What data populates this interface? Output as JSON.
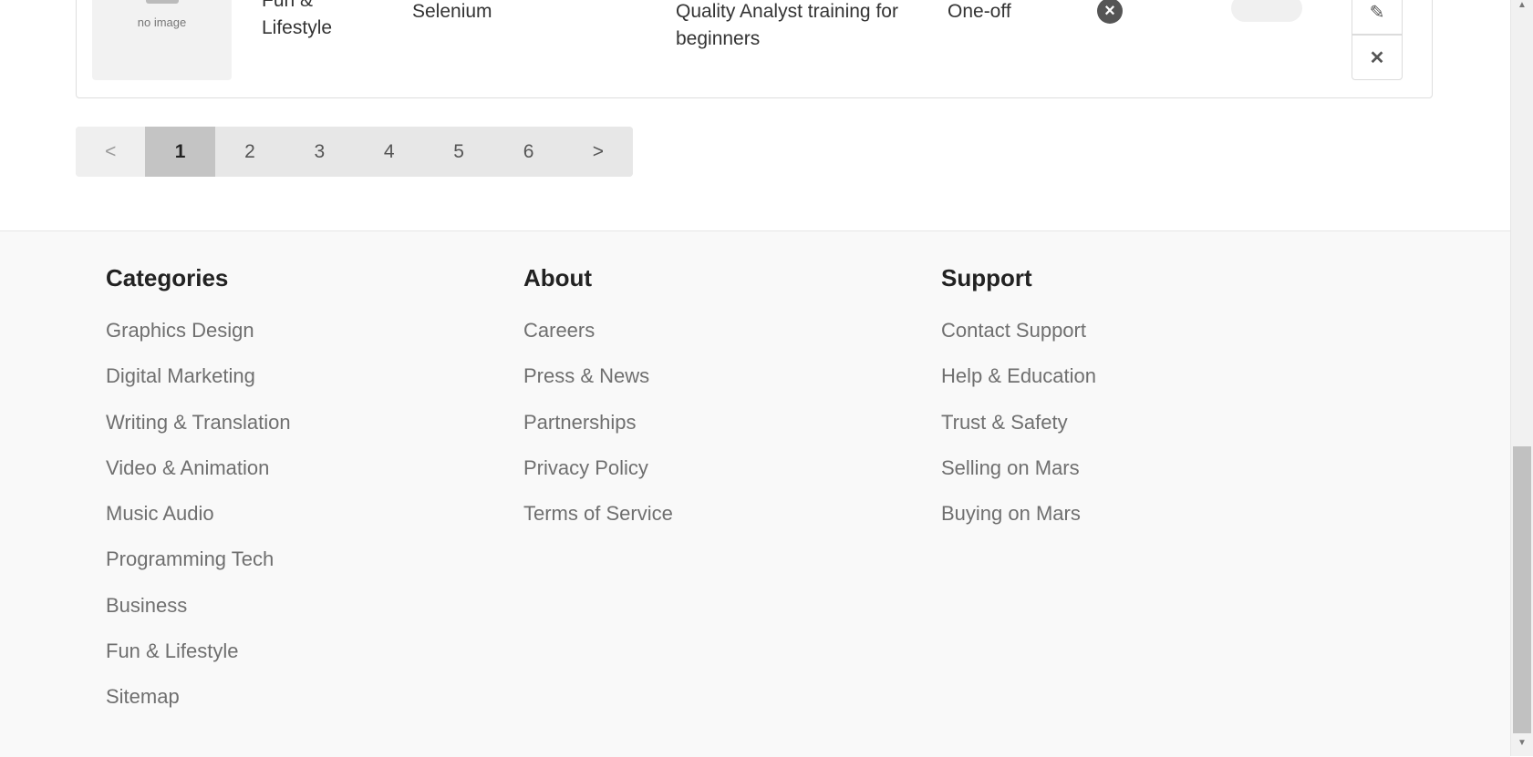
{
  "row": {
    "thumbnail_text": "no image",
    "category": "Fun & Lifestyle",
    "skill": "Selenium",
    "description": "Quality Analyst training for beginners",
    "type": "One-off",
    "status_icon": "close-circle-icon",
    "edit_icon": "pencil-icon",
    "delete_icon": "x-icon"
  },
  "pagination": {
    "prev": "<",
    "pages": [
      "1",
      "2",
      "3",
      "4",
      "5",
      "6"
    ],
    "active": "1",
    "next": ">"
  },
  "footer": {
    "categories": {
      "title": "Categories",
      "items": [
        "Graphics Design",
        "Digital Marketing",
        "Writing & Translation",
        "Video & Animation",
        "Music Audio",
        "Programming Tech",
        "Business",
        "Fun & Lifestyle",
        "Sitemap"
      ]
    },
    "about": {
      "title": "About",
      "items": [
        "Careers",
        "Press & News",
        "Partnerships",
        "Privacy Policy",
        "Terms of Service"
      ]
    },
    "support": {
      "title": "Support",
      "items": [
        "Contact Support",
        "Help & Education",
        "Trust & Safety",
        "Selling on Mars",
        "Buying on Mars"
      ]
    }
  },
  "colors": {
    "footer_bg": "#f9f9f9",
    "link_gray": "#6f6f6f",
    "active_page": "#c4c4c4"
  }
}
